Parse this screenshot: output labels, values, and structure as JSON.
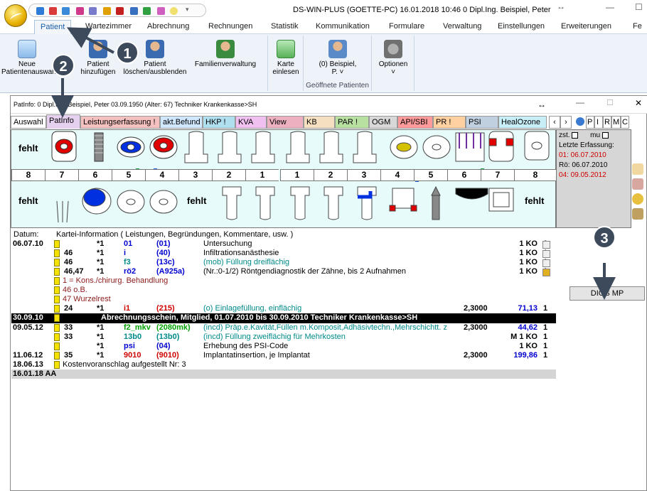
{
  "app": {
    "title": "DS-WIN-PLUS (GOETTE-PC)   16.01.2018  10:46  0  Dipl.Ing.  Beispiel, Peter",
    "restore_glyph": "↔",
    "min_glyph": "—",
    "max_glyph": "☐"
  },
  "menu": [
    "Patient",
    "Wartezimmer",
    "Abrechnung",
    "Rechnungen",
    "Statistik",
    "Kommunikation",
    "Formulare",
    "Verwaltung",
    "Einstellungen",
    "Erweiterungen",
    "Fe"
  ],
  "ribbon": {
    "new_patient": "Neue Patientenauswahl",
    "new_patient_l1": "Neue",
    "new_patient_l2": "Patientenauswahl",
    "add_patient_l1": "Patient",
    "add_patient_l2": "hinzufügen",
    "del_patient_l1": "Patient",
    "del_patient_l2": "löschen/ausblenden",
    "family": "Familienverwaltung",
    "card_l1": "Karte",
    "card_l2": "einlesen",
    "open_patient_l1": "(0) Beispiel,",
    "open_patient_l2": "P. ˅",
    "options": "Optionen",
    "options_caret": "˅",
    "group_open": "Geöffnete Patienten"
  },
  "patient_window": {
    "title": "PatInfo: 0  Dipl.Ing. Beispiel, Peter  03.09.1950 (Alter: 67)  Techniker Krankenkasse>SH",
    "restore_glyph": "↔",
    "close_glyph": "✕"
  },
  "tabs": [
    "Auswahl",
    "PatInfo",
    "Leistungserfassung !",
    "akt.Befund",
    "HKP !",
    "KVA",
    "View",
    "KB",
    "PAR !",
    "OGM",
    "API/SBI",
    "PR !",
    "PSI",
    "HealOzone"
  ],
  "tab_extra": [
    "P",
    "I",
    "R",
    "M",
    "C"
  ],
  "teeth_upper_numbers": [
    "8",
    "7",
    "6",
    "5",
    "4",
    "3",
    "2",
    "1",
    "1",
    "2",
    "3",
    "4",
    "5",
    "6",
    "7",
    "8"
  ],
  "fehlt_label": "fehlt",
  "side_info": {
    "zst": "zst.",
    "mu": "mu",
    "last_entry": "Letzte Erfassung:",
    "e1": "01: 06.07.2010",
    "e2": "Rö: 06.07.2010",
    "e3": "04: 09.05.2012"
  },
  "record_header": {
    "datum": "Datum:",
    "info": "Kartei-Information ( Leistungen, Begründungen, Kommentare, usw. )"
  },
  "records": [
    {
      "date": "06.07.10",
      "tooth": "",
      "count": "*1",
      "code": "01",
      "code_color": "blue",
      "num": "(01)",
      "num_color": "blue",
      "desc": "Untersuchung",
      "desc_color": "",
      "factor": "",
      "amount": "1 KO",
      "amount_color": "",
      "qty": "0"
    },
    {
      "date": "",
      "tooth": "46",
      "count": "*1",
      "code": "i",
      "code_color": "blue",
      "num": "(40)",
      "num_color": "blue",
      "desc": "Infiltrationsanästhesie",
      "desc_color": "",
      "factor": "",
      "amount": "1 KO",
      "amount_color": "",
      "qty": "1"
    },
    {
      "date": "",
      "tooth": "46",
      "count": "*1",
      "code": "f3",
      "code_color": "teal",
      "num": "(13c)",
      "num_color": "blue",
      "desc": "(mob) Füllung dreiflächig",
      "desc_color": "teal",
      "factor": "",
      "amount": "1 KO",
      "amount_color": "",
      "qty": "1"
    },
    {
      "date": "",
      "tooth": "46,47",
      "count": "*1",
      "code": "rö2",
      "code_color": "blue",
      "num": "(A925a)",
      "num_color": "blue",
      "desc": "(Nr.:0-1/2) Röntgendiagnostik der Zähne, bis 2 Aufnahmen",
      "desc_color": "",
      "factor": "",
      "amount": "1 KO",
      "amount_color": "",
      "qty": "1"
    },
    {
      "note": "1 = Kons./chirurg. Behandlung"
    },
    {
      "note": "46 o.B."
    },
    {
      "note": "47 Wurzelrest"
    },
    {
      "date": "",
      "tooth": "24",
      "count": "*1",
      "code": "i1",
      "code_color": "red",
      "num": "(215)",
      "num_color": "red",
      "desc": "(o) Einlagefüllung, einflächig",
      "desc_color": "teal",
      "factor": "2,3000",
      "amount": "71,13",
      "amount_color": "blue",
      "qty": "1"
    },
    {
      "black": "Abrechnungsschein, Mitglied, 01.07.2010 bis 30.09.2010  Techniker Krankenkasse>SH",
      "date": "30.09.10"
    },
    {
      "date": "09.05.12",
      "tooth": "33",
      "count": "*1",
      "code": "f2_mkv",
      "code_color": "green",
      "num": "(2080mk)",
      "num_color": "green",
      "desc": "(incd) Präp.e.Kavität,Füllen m.Komposit,Adhäsivtechn.,Mehrschichtt. z",
      "desc_color": "teal",
      "factor": "2,3000",
      "amount": "44,62",
      "amount_color": "blue",
      "qty": "1"
    },
    {
      "date": "",
      "tooth": "33",
      "count": "*1",
      "code": "13b0",
      "code_color": "teal",
      "num": "(13b0)",
      "num_color": "teal",
      "desc": "(incd) Füllung zweiflächig für Mehrkosten",
      "desc_color": "teal",
      "factor": "",
      "amount": "M  1 KO",
      "amount_color": "",
      "qty": "1"
    },
    {
      "date": "",
      "tooth": "",
      "count": "*1",
      "code": "psi",
      "code_color": "blue",
      "num": "(04)",
      "num_color": "blue",
      "desc": "Erhebung des PSI-Code",
      "desc_color": "",
      "factor": "",
      "amount": "1 KO",
      "amount_color": "",
      "qty": "1"
    },
    {
      "date": "11.06.12",
      "tooth": "35",
      "count": "*1",
      "code": "9010",
      "code_color": "red",
      "num": "(9010)",
      "num_color": "red",
      "desc": "Implantatinsertion, je Implantat",
      "desc_color": "",
      "factor": "2,3000",
      "amount": "199,86",
      "amount_color": "blue",
      "qty": "1"
    },
    {
      "date": "18.06.13",
      "tooth": "",
      "count": "",
      "code": "",
      "num": "",
      "desc": "Kostenvoranschlag aufgestellt Nr:  3",
      "desc_color": "",
      "factor": "",
      "amount": "",
      "qty": "",
      "kv": true
    },
    {
      "grey": true,
      "date": "16.01.18 AA"
    }
  ],
  "dios_button": "DIOS MP",
  "callouts": [
    "1",
    "2",
    "3"
  ]
}
